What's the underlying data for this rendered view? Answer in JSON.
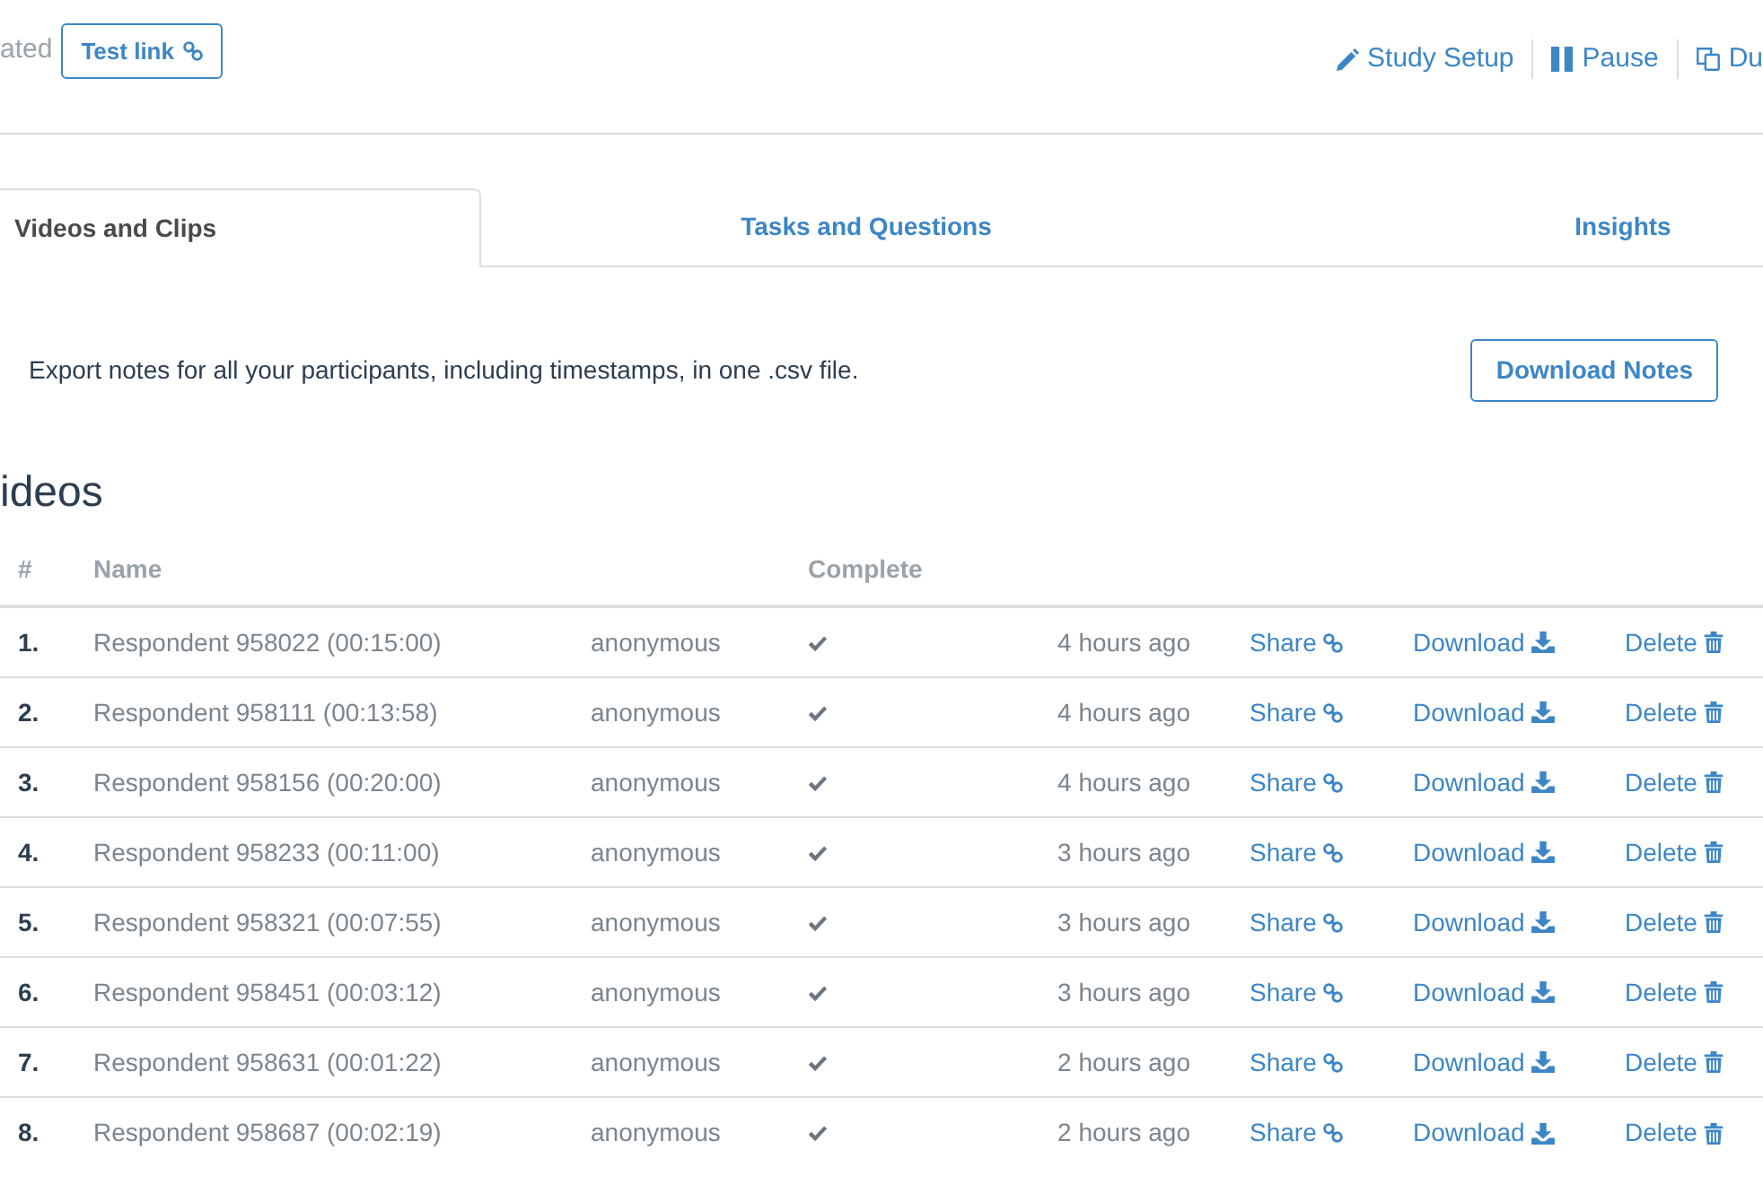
{
  "header": {
    "status_text": "ated",
    "test_link": {
      "label": "Test link"
    },
    "actions": [
      {
        "kind": "edit",
        "label": "Study Setup"
      },
      {
        "kind": "pause",
        "label": "Pause"
      },
      {
        "kind": "duplicate",
        "label": "Du"
      }
    ]
  },
  "tabs": [
    {
      "label": "Videos and Clips",
      "selected": true
    },
    {
      "label": "Tasks and Questions",
      "selected": false
    },
    {
      "label": "Insights",
      "selected": false
    }
  ],
  "export": {
    "description": "Export notes for all your participants, including timestamps, in one .csv file.",
    "button": "Download Notes"
  },
  "section_title": "ideos",
  "table": {
    "columns": [
      "#",
      "Name",
      "Complete"
    ],
    "rows": [
      {
        "number": "1.",
        "name": "Respondent 958022 (00:15:00)",
        "user": "anonymous",
        "complete": true,
        "time": "4 hours ago",
        "actions": [
          {
            "kind": "share",
            "label": "Share"
          },
          {
            "kind": "download",
            "label": "Download"
          },
          {
            "kind": "delete",
            "label": "Delete"
          }
        ]
      },
      {
        "number": "2.",
        "name": "Respondent 958111 (00:13:58)",
        "user": "anonymous",
        "complete": true,
        "time": "4 hours ago",
        "actions": [
          {
            "kind": "share",
            "label": "Share"
          },
          {
            "kind": "download",
            "label": "Download"
          },
          {
            "kind": "delete",
            "label": "Delete"
          }
        ]
      },
      {
        "number": "3.",
        "name": "Respondent 958156 (00:20:00)",
        "user": "anonymous",
        "complete": true,
        "time": "4 hours ago",
        "actions": [
          {
            "kind": "share",
            "label": "Share"
          },
          {
            "kind": "download",
            "label": "Download"
          },
          {
            "kind": "delete",
            "label": "Delete"
          }
        ]
      },
      {
        "number": "4.",
        "name": "Respondent 958233 (00:11:00)",
        "user": "anonymous",
        "complete": true,
        "time": "3 hours ago",
        "actions": [
          {
            "kind": "share",
            "label": "Share"
          },
          {
            "kind": "download",
            "label": "Download"
          },
          {
            "kind": "delete",
            "label": "Delete"
          }
        ]
      },
      {
        "number": "5.",
        "name": "Respondent 958321 (00:07:55)",
        "user": "anonymous",
        "complete": true,
        "time": "3 hours ago",
        "actions": [
          {
            "kind": "share",
            "label": "Share"
          },
          {
            "kind": "download",
            "label": "Download"
          },
          {
            "kind": "delete",
            "label": "Delete"
          }
        ]
      },
      {
        "number": "6.",
        "name": "Respondent 958451 (00:03:12)",
        "user": "anonymous",
        "complete": true,
        "time": "3 hours ago",
        "actions": [
          {
            "kind": "share",
            "label": "Share"
          },
          {
            "kind": "download",
            "label": "Download"
          },
          {
            "kind": "delete",
            "label": "Delete"
          }
        ]
      },
      {
        "number": "7.",
        "name": "Respondent 958631 (00:01:22)",
        "user": "anonymous",
        "complete": true,
        "time": "2 hours ago",
        "actions": [
          {
            "kind": "share",
            "label": "Share"
          },
          {
            "kind": "download",
            "label": "Download"
          },
          {
            "kind": "delete",
            "label": "Delete"
          }
        ]
      },
      {
        "number": "8.",
        "name": "Respondent 958687 (00:02:19)",
        "user": "anonymous",
        "complete": true,
        "time": "2 hours ago",
        "actions": [
          {
            "kind": "share",
            "label": "Share"
          },
          {
            "kind": "download",
            "label": "Download"
          },
          {
            "kind": "delete",
            "label": "Delete"
          }
        ]
      }
    ]
  }
}
